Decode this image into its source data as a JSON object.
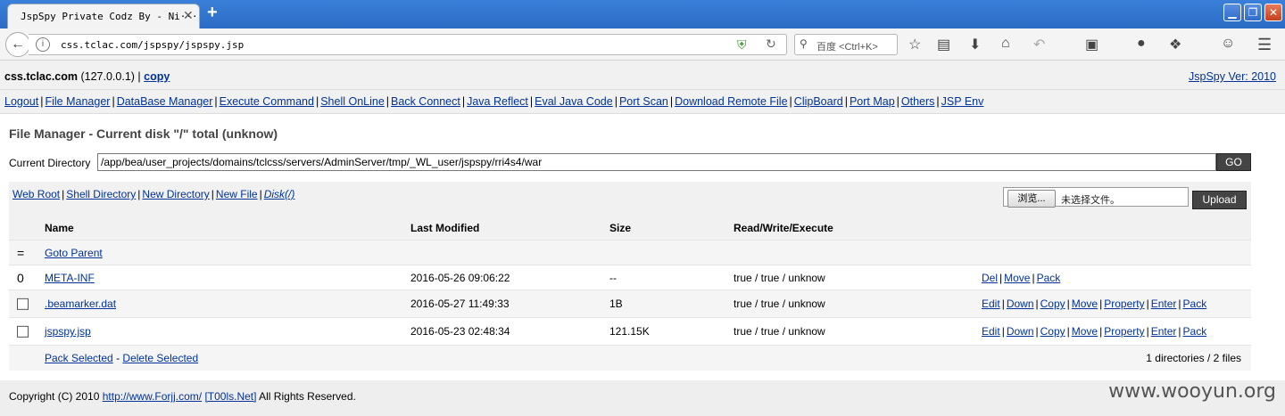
{
  "browser": {
    "tab_title": "JspSpy Private Codz By - Ni···",
    "tab_close": "✕",
    "new_tab": "+",
    "url": "css.tclac.com/jspspy/jspspy.jsp",
    "search_placeholder": "百度 <Ctrl+K>",
    "window_controls": [
      "▁",
      "❐",
      "✕"
    ],
    "icons": [
      "star-icon",
      "clipboard-icon",
      "download-icon",
      "home-icon",
      "undo-icon",
      "crop-icon",
      "chat-icon",
      "plugin-icon",
      "emoji-icon",
      "menu-icon"
    ]
  },
  "header": {
    "host": "css.tclac.com",
    "host_ip": "(127.0.0.1) |",
    "copy_link": "copy",
    "version_link": "JspSpy Ver: 2010"
  },
  "menu": [
    "Logout",
    "File Manager",
    "DataBase Manager",
    "Execute Command",
    "Shell OnLine",
    "Back Connect",
    "Java Reflect",
    "Eval Java Code",
    "Port Scan",
    "Download Remote File",
    "ClipBoard",
    "Port Map",
    "Others",
    "JSP Env"
  ],
  "file_manager": {
    "title": "File Manager - Current disk \"/\" total (unknow)",
    "current_dir_label": "Current Directory",
    "current_dir_value": "/app/bea/user_projects/domains/tclcss/servers/AdminServer/tmp/_WL_user/jspspy/rri4s4/war",
    "go_button": "GO",
    "tool_links": [
      "Web Root",
      "Shell Directory",
      "New Directory",
      "New File",
      "Disk(/)"
    ],
    "browse_button": "浏览...",
    "no_file_text": "未选择文件。",
    "upload_button": "Upload",
    "columns": [
      "Name",
      "Last Modified",
      "Size",
      "Read/Write/Execute"
    ],
    "parent_marker": "=",
    "goto_parent": "Goto Parent",
    "rows": [
      {
        "marker": "0",
        "name": "META-INF",
        "modified": "2016-05-26 09:06:22",
        "size": "--",
        "rwx": "true / true / unknow",
        "actions": [
          "Del",
          "Move",
          "Pack"
        ]
      },
      {
        "marker": "",
        "name": ".beamarker.dat",
        "modified": "2016-05-27 11:49:33",
        "size": "1B",
        "rwx": "true / true / unknow",
        "actions": [
          "Edit",
          "Down",
          "Copy",
          "Move",
          "Property",
          "Enter",
          "Pack"
        ]
      },
      {
        "marker": "",
        "name": "jspspy.jsp",
        "modified": "2016-05-23 02:48:34",
        "size": "121.15K",
        "rwx": "true / true / unknow",
        "actions": [
          "Edit",
          "Down",
          "Copy",
          "Move",
          "Property",
          "Enter",
          "Pack"
        ]
      }
    ],
    "pack_selected": "Pack Selected",
    "delete_selected": "Delete Selected",
    "dash": "-",
    "count": "1 directories / 2 files"
  },
  "footer": {
    "copyright_prefix": "Copyright (C) 2010",
    "link1": "http://www.Forjj.com/",
    "link2": "[T00ls.Net]",
    "suffix": "All Rights Reserved.",
    "watermark": "www.wooyun.org"
  }
}
